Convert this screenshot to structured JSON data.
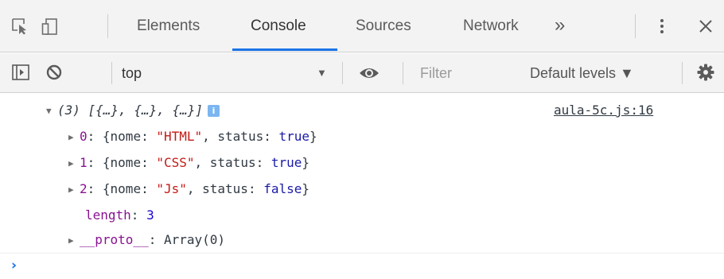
{
  "devtools": {
    "tabs": [
      {
        "label": "Elements",
        "active": false
      },
      {
        "label": "Console",
        "active": true
      },
      {
        "label": "Sources",
        "active": false
      },
      {
        "label": "Network",
        "active": false
      }
    ],
    "more_tabs_glyph": "»",
    "icons": [
      "inspect-element-icon",
      "device-toolbar-icon",
      "more-tabs-icon",
      "kebab-menu-icon",
      "close-icon"
    ]
  },
  "toolbar": {
    "context": "top",
    "context_arrow": "▼",
    "filter_placeholder": "Filter",
    "levels_label": "Default levels ▼",
    "icons": [
      "sidebar-toggle-icon",
      "clear-console-icon",
      "eye-icon",
      "gear-icon"
    ]
  },
  "console": {
    "summary": "(3) [{…}, {…}, {…}]",
    "info_badge": "i",
    "source_link": "aula-5c.js:16",
    "items": [
      {
        "index": "0",
        "nome": "\"HTML\"",
        "status": "true"
      },
      {
        "index": "1",
        "nome": "\"CSS\"",
        "status": "true"
      },
      {
        "index": "2",
        "nome": "\"Js\"",
        "status": "false"
      }
    ],
    "length_key": "length",
    "length_value": "3",
    "proto_key": "__proto__",
    "proto_value": "Array(0)",
    "prompt_glyph": "›"
  },
  "colors": {
    "accent": "#1a73e8",
    "chrome_bg": "#f3f3f3",
    "string": "#c41a16",
    "keyword": "#1a1aa6",
    "property": "#881391"
  }
}
